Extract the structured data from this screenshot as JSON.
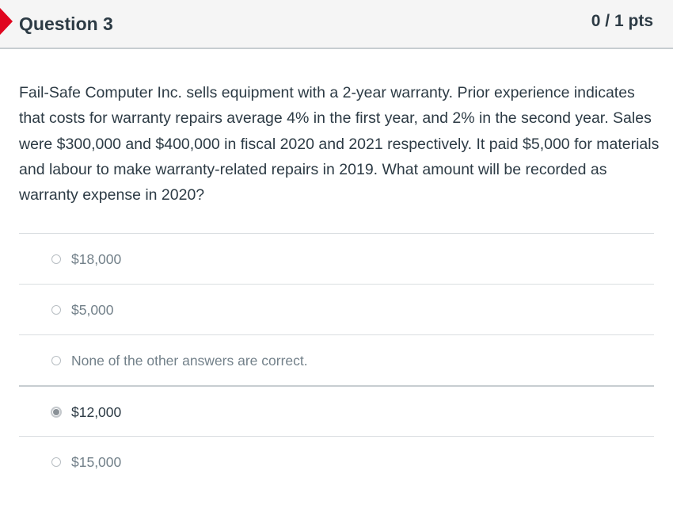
{
  "question": {
    "title": "Question 3",
    "points": "0 / 1 pts",
    "status_icon": "incorrect-flag-icon",
    "text": "Fail-Safe Computer Inc. sells equipment with a 2-year warranty. Prior experience indicates that costs for warranty repairs average 4% in the first year, and 2% in the second year. Sales were $300,000 and $400,000 in fiscal 2020 and 2021 respectively. It paid $5,000 for materials and labour to make warranty-related repairs in 2019. What amount will be recorded as warranty expense in 2020?"
  },
  "answers": [
    {
      "label": "$18,000",
      "selected": false
    },
    {
      "label": "$5,000",
      "selected": false
    },
    {
      "label": "None of the other answers are correct.",
      "selected": false
    },
    {
      "label": "$12,000",
      "selected": true
    },
    {
      "label": "$15,000",
      "selected": false
    }
  ],
  "colors": {
    "incorrect_flag": "#e0061f",
    "text": "#2d3b45",
    "muted_text": "#73818a"
  }
}
